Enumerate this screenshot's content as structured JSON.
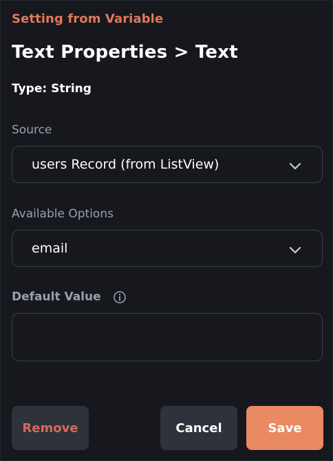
{
  "header": {
    "eyebrow": "Setting from Variable",
    "title": "Text Properties > Text",
    "type": "Type: String"
  },
  "source": {
    "label": "Source",
    "value": "users Record (from ListView)"
  },
  "available_options": {
    "label": "Available Options",
    "value": "email"
  },
  "default_value": {
    "label": "Default Value",
    "value": "",
    "placeholder": ""
  },
  "buttons": {
    "remove": "Remove",
    "cancel": "Cancel",
    "save": "Save"
  },
  "colors": {
    "background": "#16181d",
    "accent": "#e0785a",
    "save_button": "#e98a62",
    "remove_text": "#d46a5a",
    "secondary_button": "#2e323a",
    "border": "#3a3e47",
    "muted_text": "#9aa0ab"
  },
  "icons": {
    "dropdown": "chevron-down-icon",
    "info": "info-icon"
  }
}
